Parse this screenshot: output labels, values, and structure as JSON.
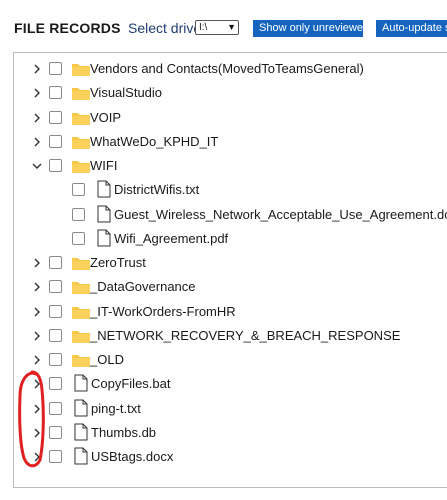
{
  "header": {
    "title": "FILE RECORDS",
    "drive_label": "Select drive:",
    "drive_value": "I:\\",
    "btn_unreviewed": "Show only unreviewed",
    "btn_autoupdate": "Auto-update se"
  },
  "tree": {
    "rows": [
      {
        "label": "Vendors and Contacts(MovedToTeamsGeneral)",
        "kind": "folder",
        "caret": "collapsed",
        "level": 0
      },
      {
        "label": "VisualStudio",
        "kind": "folder",
        "caret": "collapsed",
        "level": 0
      },
      {
        "label": "VOIP",
        "kind": "folder",
        "caret": "collapsed",
        "level": 0
      },
      {
        "label": "WhatWeDo_KPHD_IT",
        "kind": "folder",
        "caret": "collapsed",
        "level": 0
      },
      {
        "label": "WIFI",
        "kind": "folder",
        "caret": "expanded",
        "level": 0
      },
      {
        "label": "DistrictWifis.txt",
        "kind": "file",
        "caret": "none",
        "level": 1
      },
      {
        "label": "Guest_Wireless_Network_Acceptable_Use_Agreement.docx",
        "kind": "file",
        "caret": "none",
        "level": 1
      },
      {
        "label": "Wifi_Agreement.pdf",
        "kind": "file",
        "caret": "none",
        "level": 1
      },
      {
        "label": "ZeroTrust",
        "kind": "folder",
        "caret": "collapsed",
        "level": 0
      },
      {
        "label": "_DataGovernance",
        "kind": "folder",
        "caret": "collapsed",
        "level": 0
      },
      {
        "label": "_IT-WorkOrders-FromHR",
        "kind": "folder",
        "caret": "collapsed",
        "level": 0
      },
      {
        "label": "_NETWORK_RECOVERY_&_BREACH_RESPONSE",
        "kind": "folder",
        "caret": "collapsed",
        "level": 0
      },
      {
        "label": "_OLD",
        "kind": "folder",
        "caret": "collapsed",
        "level": 0
      },
      {
        "label": "CopyFiles.bat",
        "kind": "file",
        "caret": "collapsed",
        "level": 0
      },
      {
        "label": "ping-t.txt",
        "kind": "file",
        "caret": "collapsed",
        "level": 0
      },
      {
        "label": "Thumbs.db",
        "kind": "file",
        "caret": "collapsed",
        "level": 0
      },
      {
        "label": "USBtags.docx",
        "kind": "file",
        "caret": "collapsed",
        "level": 0
      }
    ]
  },
  "icons": {
    "collapsed_caret": "chevron-right-icon",
    "expanded_caret": "chevron-down-icon",
    "folder": "folder-icon",
    "file": "file-icon"
  },
  "colors": {
    "button_bg": "#1565c0",
    "folder": "#f7c948",
    "annotation": "#e02020",
    "drive_label": "#1f3b74"
  }
}
